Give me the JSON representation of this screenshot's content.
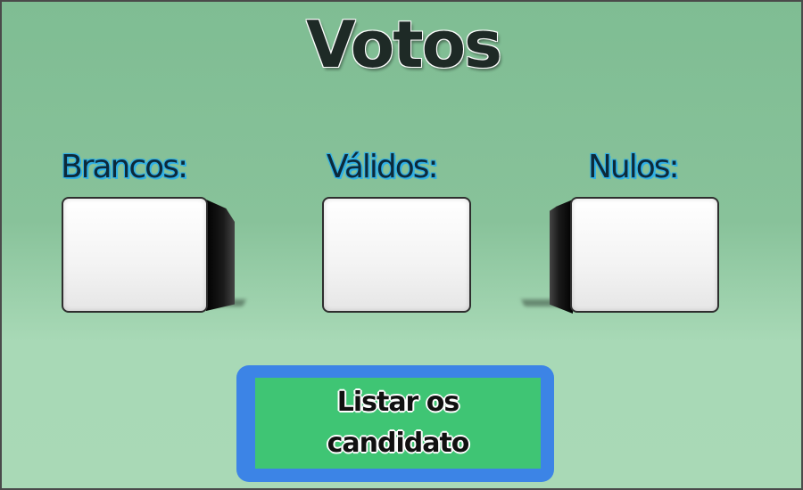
{
  "window": {
    "title": "Votos"
  },
  "fields": {
    "brancos": {
      "label": "Brancos:",
      "value": ""
    },
    "validos": {
      "label": "Válidos:",
      "value": ""
    },
    "nulos": {
      "label": "Nulos:",
      "value": ""
    }
  },
  "actions": {
    "list_candidates_label": "Listar os candidato"
  },
  "colors": {
    "background_top": "#7fbd93",
    "background_bottom": "#a9d9b6",
    "label_outline": "#31b0e6",
    "button_border": "#3c84e6",
    "button_fill": "#3fc574"
  }
}
